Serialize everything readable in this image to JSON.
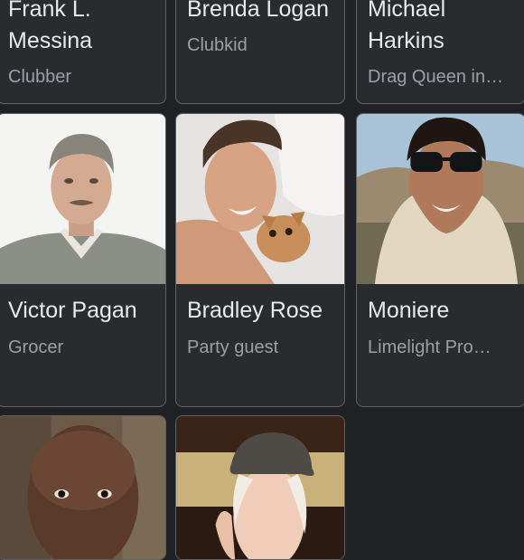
{
  "people": [
    {
      "name_line1": "Frank L.",
      "name_line2": "Messina",
      "role": "Clubber"
    },
    {
      "name_line1": "Brenda Logan",
      "name_line2": "",
      "role": "Clubkid"
    },
    {
      "name_line1": "Michael",
      "name_line2": "Harkins",
      "role": "Drag Queen in…"
    },
    {
      "name": "Victor Pagan",
      "role": "Grocer",
      "photo": "portrait-white-background"
    },
    {
      "name": "Bradley Rose",
      "role": "Party guest",
      "photo": "portrait-with-small-dog"
    },
    {
      "name": "Moniere",
      "role": "Limelight Pro…",
      "photo": "portrait-sunglasses-scarf"
    },
    {
      "name": "",
      "role": "",
      "photo": "portrait-bald-man"
    },
    {
      "name": "",
      "role": "",
      "photo": "portrait-woman-cap"
    }
  ],
  "colors": {
    "background": "#202124",
    "card": "#2a2b2e",
    "border": "#5f6368",
    "name_text": "#e8eaed",
    "role_text": "#9aa0a6"
  }
}
